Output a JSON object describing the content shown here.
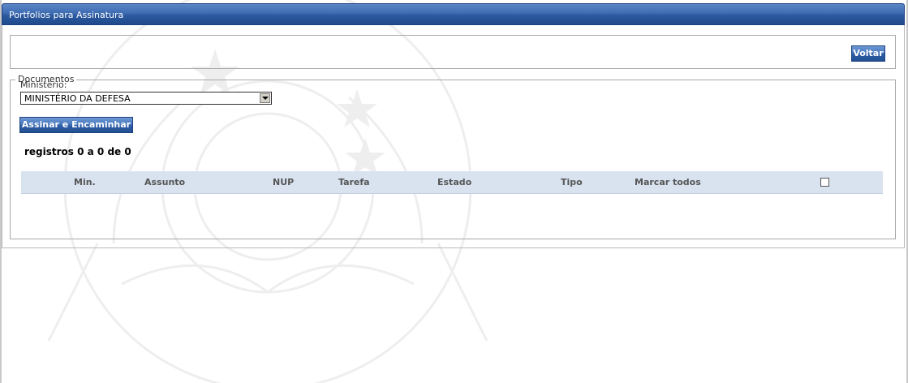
{
  "panel": {
    "title": "Portfolios para Assinatura"
  },
  "toolbar": {
    "back_label": "Voltar"
  },
  "documents": {
    "legend": "Documentos",
    "ministry_label": "Ministério:",
    "ministry_selected": "MINISTÉRIO DA DEFESA",
    "sign_button_label": "Assinar e Encaminhar",
    "records_text": "registros 0 a 0 de 0"
  },
  "table": {
    "columns": [
      "Min.",
      "Assunto",
      "NUP",
      "Tarefa",
      "Estado",
      "Tipo",
      "Marcar todos"
    ],
    "rows": []
  },
  "colors": {
    "header_blue": "#2d5aa0",
    "table_header_bg": "#d9e3f0"
  }
}
